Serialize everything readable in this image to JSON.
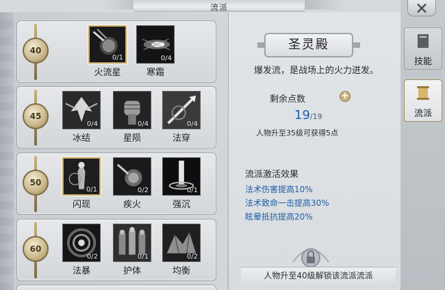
{
  "window": {
    "title": "流派"
  },
  "tiers": [
    {
      "level": "40",
      "skills": [
        {
          "name": "火流星",
          "count": "0/1",
          "icon": "meteor-icon",
          "selected": true
        },
        {
          "name": "寒霜",
          "count": "0/4",
          "icon": "frost-icon",
          "selected": false
        }
      ]
    },
    {
      "level": "45",
      "skills": [
        {
          "name": "冰结",
          "count": "0/4",
          "icon": "ice-bird-icon",
          "selected": false
        },
        {
          "name": "星陨",
          "count": "0/4",
          "icon": "fist-icon",
          "selected": false
        },
        {
          "name": "法穿",
          "count": "0/4",
          "icon": "spear-icon",
          "selected": false
        }
      ]
    },
    {
      "level": "50",
      "skills": [
        {
          "name": "闪现",
          "count": "0/1",
          "icon": "blink-icon",
          "selected": true
        },
        {
          "name": "疾火",
          "count": "0/2",
          "icon": "fireball-icon",
          "selected": false
        },
        {
          "name": "强沉",
          "count": "0/1",
          "icon": "beam-icon",
          "selected": false
        }
      ]
    },
    {
      "level": "60",
      "skills": [
        {
          "name": "法暴",
          "count": "0/2",
          "icon": "vortex-icon",
          "selected": false
        },
        {
          "name": "护体",
          "count": "0/1",
          "icon": "guards-icon",
          "selected": false
        },
        {
          "name": "均衡",
          "count": "0/2",
          "icon": "rock-icon",
          "selected": false
        }
      ]
    }
  ],
  "school": {
    "name": "圣灵殿",
    "description": "爆发流，是战场上的火力迸发。",
    "points_label": "剩余点数",
    "points_current": "19",
    "points_total": "/19",
    "points_hint": "人物升至35级可获得5点",
    "effects_title": "流派激活效果",
    "effects": [
      "法术伤害提高10%",
      "法术致命一击提高30%",
      "眩晕抵抗提高20%"
    ],
    "unlock_text": "人物升至40级解锁该流派流派"
  },
  "tabs": [
    {
      "label": "技能",
      "icon": "book-icon"
    },
    {
      "label": "流派",
      "icon": "scroll-icon",
      "active": true
    }
  ],
  "colors": {
    "accent_blue": "#1f5fa8",
    "gold": "#c7a56a"
  }
}
